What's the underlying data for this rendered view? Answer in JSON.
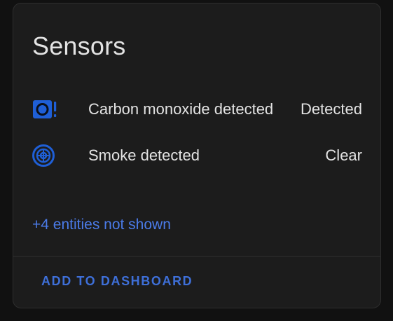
{
  "card": {
    "title": "Sensors",
    "entities": [
      {
        "name": "Carbon monoxide detected",
        "state": "Detected",
        "icon": "carbon-monoxide-alert-icon"
      },
      {
        "name": "Smoke detected",
        "state": "Clear",
        "icon": "smoke-detector-icon"
      }
    ],
    "hidden_entities_label": "+4 entities not shown",
    "action_label": "ADD TO DASHBOARD"
  },
  "colors": {
    "background": "#111111",
    "card": "#1c1c1c",
    "text": "#e3e3e3",
    "accent": "#3e6fd8",
    "icon": "#1f5fd6"
  }
}
